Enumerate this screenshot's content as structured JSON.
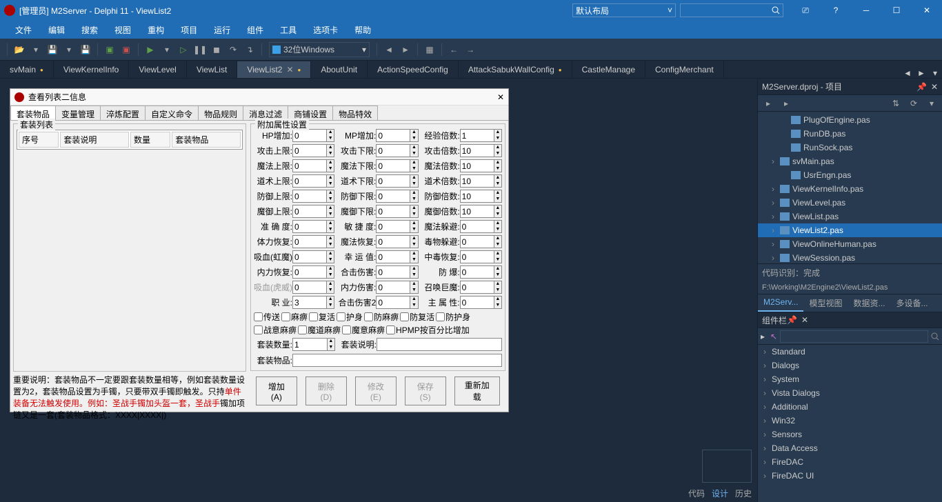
{
  "titlebar": {
    "title": "[管理员] M2Server - Delphi 11 - ViewList2",
    "layout_combo": "默认布局"
  },
  "menus": [
    "文件",
    "编辑",
    "搜索",
    "视图",
    "重构",
    "项目",
    "运行",
    "组件",
    "工具",
    "选项卡",
    "帮助"
  ],
  "platform_combo": "32位Windows",
  "editor_tabs": [
    {
      "label": "svMain",
      "dirty": true,
      "active": false
    },
    {
      "label": "ViewKernelInfo",
      "dirty": false,
      "active": false
    },
    {
      "label": "ViewLevel",
      "dirty": false,
      "active": false
    },
    {
      "label": "ViewList",
      "dirty": false,
      "active": false
    },
    {
      "label": "ViewList2",
      "dirty": true,
      "active": true
    },
    {
      "label": "AboutUnit",
      "dirty": false,
      "active": false
    },
    {
      "label": "ActionSpeedConfig",
      "dirty": false,
      "active": false
    },
    {
      "label": "AttackSabukWallConfig",
      "dirty": true,
      "active": false
    },
    {
      "label": "CastleManage",
      "dirty": false,
      "active": false
    },
    {
      "label": "ConfigMerchant",
      "dirty": false,
      "active": false
    }
  ],
  "dialog": {
    "title": "查看列表二信息",
    "sub_tabs": [
      "套装物品",
      "变量管理",
      "淬炼配置",
      "自定义命令",
      "物品规则",
      "消息过滤",
      "商铺设置",
      "物品特效"
    ],
    "list_group_title": "套装列表",
    "list_columns": [
      "序号",
      "套装说明",
      "数量",
      "套装物品"
    ],
    "help_line1": "重要说明：套装物品不一定要跟套装数量相等，例如套装数量设置为2，套装物品设置为手镯，只要带双手镯即触发。只持",
    "help_red": "单件装备无法触发使用。例如：圣战手镯加头盔一套，圣战手",
    "help_line2": "镯加项链又是一套(套装物品格式：XXXX|XXXX|)",
    "attr_group_title": "附加属性设置",
    "fields": [
      [
        {
          "lbl": "HP增加:",
          "val": "0"
        },
        {
          "lbl": "MP增加:",
          "val": "0"
        },
        {
          "lbl": "经验倍数:",
          "val": "1"
        }
      ],
      [
        {
          "lbl": "攻击上限:",
          "val": "0"
        },
        {
          "lbl": "攻击下限:",
          "val": "0"
        },
        {
          "lbl": "攻击倍数:",
          "val": "10"
        }
      ],
      [
        {
          "lbl": "魔法上限:",
          "val": "0"
        },
        {
          "lbl": "魔法下限:",
          "val": "0"
        },
        {
          "lbl": "魔法倍数:",
          "val": "10"
        }
      ],
      [
        {
          "lbl": "道术上限:",
          "val": "0"
        },
        {
          "lbl": "道术下限:",
          "val": "0"
        },
        {
          "lbl": "道术倍数:",
          "val": "10"
        }
      ],
      [
        {
          "lbl": "防御上限:",
          "val": "0"
        },
        {
          "lbl": "防御下限:",
          "val": "0"
        },
        {
          "lbl": "防御倍数:",
          "val": "10"
        }
      ],
      [
        {
          "lbl": "魔御上限:",
          "val": "0"
        },
        {
          "lbl": "魔御下限:",
          "val": "0"
        },
        {
          "lbl": "魔御倍数:",
          "val": "10"
        }
      ],
      [
        {
          "lbl": "准 确 度:",
          "val": "0"
        },
        {
          "lbl": "敏 捷 度:",
          "val": "0"
        },
        {
          "lbl": "魔法躲避:",
          "val": "0"
        }
      ],
      [
        {
          "lbl": "体力恢复:",
          "val": "0"
        },
        {
          "lbl": "魔法恢复:",
          "val": "0"
        },
        {
          "lbl": "毒物躲避:",
          "val": "0"
        }
      ],
      [
        {
          "lbl": "吸血(虹魔)",
          "val": "0"
        },
        {
          "lbl": "幸 运 值:",
          "val": "0"
        },
        {
          "lbl": "中毒恢复:",
          "val": "0"
        }
      ],
      [
        {
          "lbl": "内力恢复:",
          "val": "0"
        },
        {
          "lbl": "合击伤害:",
          "val": "0"
        },
        {
          "lbl": "防    爆:",
          "val": "0"
        }
      ],
      [
        {
          "lbl": "吸血(虎威)",
          "val": "0",
          "disabled": true
        },
        {
          "lbl": "内力伤害:",
          "val": "0"
        },
        {
          "lbl": "召唤巨魔:",
          "val": "0"
        }
      ],
      [
        {
          "lbl": "职    业:",
          "val": "3"
        },
        {
          "lbl": "合击伤害2",
          "val": "0"
        },
        {
          "lbl": "主 属 性:",
          "val": "0"
        }
      ]
    ],
    "checks1": [
      "传送",
      "麻痹",
      "复活",
      "护身",
      "防麻痹",
      "防复活",
      "防护身"
    ],
    "checks2": [
      "战意麻痹",
      "魔道麻痹",
      "魔意麻痹",
      "HPMP按百分比增加"
    ],
    "set_count_lbl": "套装数量:",
    "set_count_val": "1",
    "set_desc_lbl": "套装说明:",
    "set_items_lbl": "套装物品:",
    "buttons": {
      "add": "增加(A)",
      "del": "删除(D)",
      "mod": "修改(E)",
      "save": "保存(S)",
      "reload": "重新加载"
    }
  },
  "project_panel": {
    "title": "M2Server.dproj - 项目",
    "items": [
      {
        "label": "PlugOfEngine.pas",
        "child": true
      },
      {
        "label": "RunDB.pas",
        "child": true
      },
      {
        "label": "RunSock.pas",
        "child": true
      },
      {
        "label": "svMain.pas",
        "expand": true
      },
      {
        "label": "UsrEngn.pas",
        "child": true
      },
      {
        "label": "ViewKernelInfo.pas",
        "expand": true
      },
      {
        "label": "ViewLevel.pas",
        "expand": true
      },
      {
        "label": "ViewList.pas",
        "expand": true
      },
      {
        "label": "ViewList2.pas",
        "expand": true,
        "selected": true
      },
      {
        "label": "ViewOnlineHuman.pas",
        "expand": true
      },
      {
        "label": "ViewSession.pas",
        "expand": true
      }
    ],
    "status": "代码识别：完成",
    "path": "F:\\Working\\M2Engine2\\ViewList2.pas",
    "subtabs": [
      "M2Serv...",
      "模型视图",
      "数据资...",
      "多设备..."
    ]
  },
  "palette": {
    "title": "组件栏",
    "categories": [
      "Standard",
      "Dialogs",
      "System",
      "Vista Dialogs",
      "Additional",
      "Win32",
      "Sensors",
      "Data Access",
      "FireDAC",
      "FireDAC UI"
    ]
  },
  "bottom_tabs": {
    "code": "代码",
    "design": "设计",
    "history": "历史"
  }
}
